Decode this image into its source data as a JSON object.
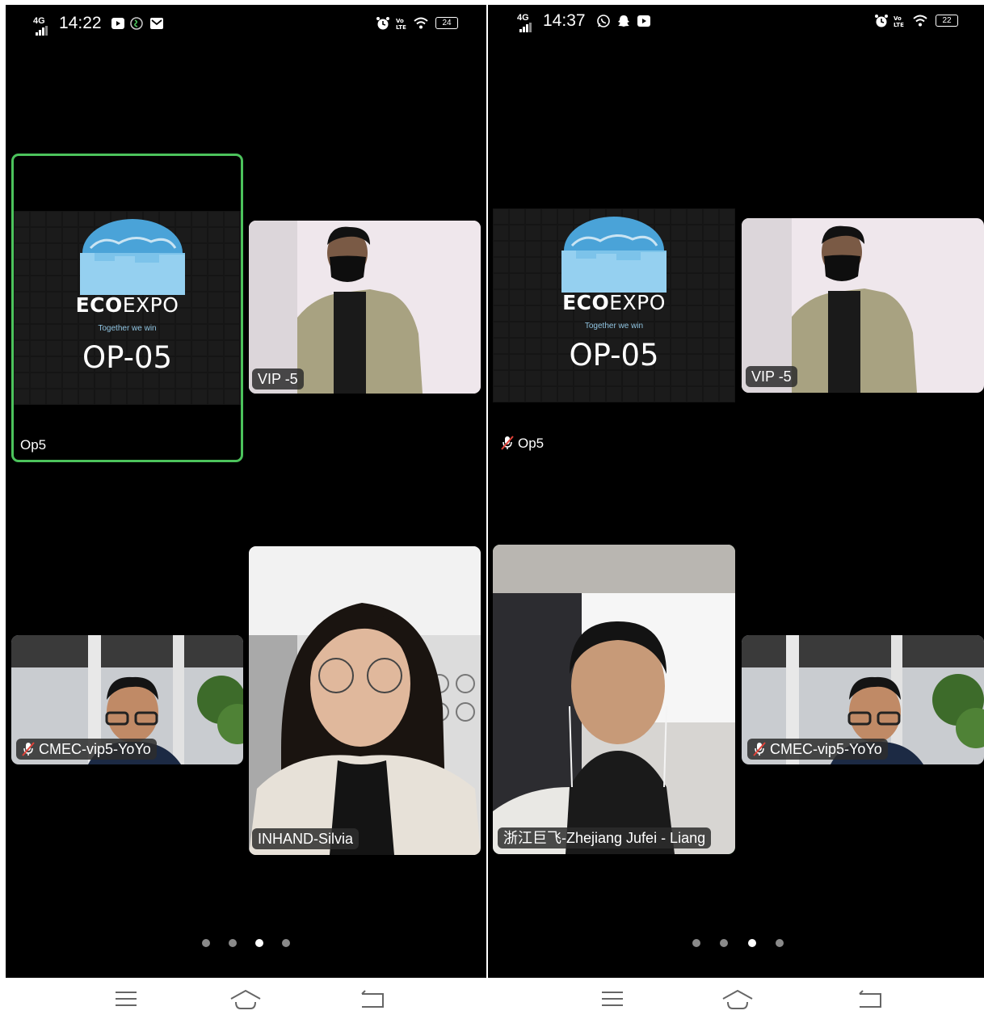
{
  "left_phone": {
    "status": {
      "signal": "4G",
      "time": "14:22",
      "battery": "24"
    },
    "tiles": {
      "op5": {
        "name": "Op5",
        "logo_brand_eco": "ECO",
        "logo_brand_expo": "EXPO",
        "logo_tagline": "Together we win",
        "logo_code": "OP-05"
      },
      "vip5": {
        "name": "VIP -5"
      },
      "yoyo": {
        "name": "CMEC-vip5-YoYo"
      },
      "silvia": {
        "name": "INHAND-Silvia"
      }
    },
    "pages": {
      "count": 4,
      "current": 3
    }
  },
  "right_phone": {
    "status": {
      "signal": "4G",
      "time": "14:37",
      "battery": "22"
    },
    "tiles": {
      "op5": {
        "name": "Op5",
        "logo_brand_eco": "ECO",
        "logo_brand_expo": "EXPO",
        "logo_tagline": "Together we win",
        "logo_code": "OP-05"
      },
      "vip5": {
        "name": "VIP -5"
      },
      "liang": {
        "name": "浙江巨飞-Zhejiang Jufei - Liang"
      },
      "yoyo": {
        "name": "CMEC-vip5-YoYo"
      }
    },
    "pages": {
      "count": 4,
      "current": 3
    }
  },
  "icons": [
    "signal-icon",
    "youtube-icon",
    "shazam-icon",
    "gmail-icon",
    "whatsapp-icon",
    "snapchat-icon",
    "alarm-icon",
    "volte-icon",
    "wifi-icon",
    "battery-icon",
    "mic-off-icon",
    "menu-icon",
    "home-icon",
    "back-icon"
  ],
  "colors": {
    "active_border": "#4cc35c",
    "background": "#000000",
    "logo_blue": "#4aa3d8"
  }
}
